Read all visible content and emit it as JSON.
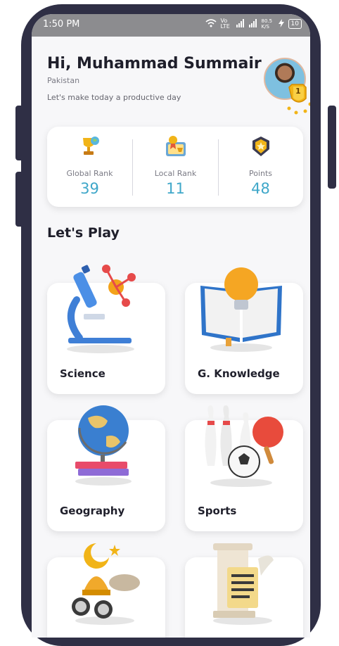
{
  "status_bar": {
    "time": "1:50 PM",
    "network_label": "Vo LTE",
    "speed": "80.5 K/S",
    "battery": "10"
  },
  "header": {
    "greeting": "Hi, Muhammad Summair",
    "country": "Pakistan",
    "tagline": "Let's make today a productive day",
    "avatar_badge_rank": "1"
  },
  "stats": [
    {
      "icon": "trophy-globe-icon",
      "label": "Global Rank",
      "value": "39"
    },
    {
      "icon": "local-rank-icon",
      "label": "Local Rank",
      "value": "11"
    },
    {
      "icon": "star-shield-icon",
      "label": "Points",
      "value": "48"
    }
  ],
  "section_title": "Let's Play",
  "categories": [
    {
      "label": "Science",
      "icon": "microscope-icon"
    },
    {
      "label": "G. Knowledge",
      "icon": "book-bulb-icon"
    },
    {
      "label": "Geography",
      "icon": "globe-icon"
    },
    {
      "label": "Sports",
      "icon": "sports-icon"
    },
    {
      "label": "",
      "icon": "islamic-crescent-icon"
    },
    {
      "label": "",
      "icon": "history-column-icon"
    }
  ],
  "colors": {
    "frame": "#2f2f45",
    "accent": "#3fa7c9",
    "background": "#f7f7f9"
  }
}
